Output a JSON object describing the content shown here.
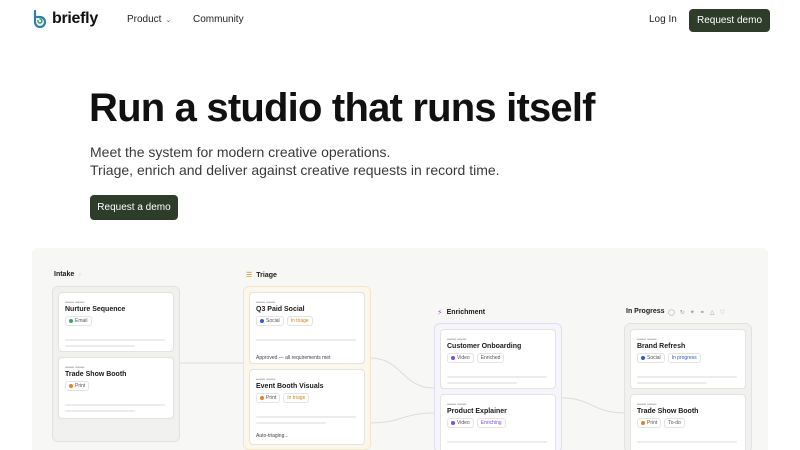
{
  "nav": {
    "brand": "briefly",
    "product": "Product",
    "community": "Community",
    "login": "Log In",
    "cta": "Request demo"
  },
  "hero": {
    "title": "Run a studio that runs itself",
    "subtitle_line1": "Meet the system for modern creative operations.",
    "subtitle_line2": "Triage, enrich and deliver against creative requests in record time.",
    "cta": "Request a demo"
  },
  "colors": {
    "brand": "#2e3d29",
    "email": "#3aa36a",
    "social": "#2f5bd3",
    "print": "#e8802a",
    "video": "#7a52d6",
    "triage_status": "#d08a1e",
    "enriching_status": "#7a52d6",
    "progress_status": "#2f5bd3"
  },
  "board": {
    "columns": [
      {
        "name": "Intake",
        "cards": [
          {
            "title": "Nurture Sequence",
            "tags": [
              {
                "label": "Email",
                "color": "#3aa36a"
              }
            ]
          },
          {
            "title": "Trade Show Booth",
            "tags": [
              {
                "label": "Print",
                "color": "#e8802a"
              }
            ]
          }
        ]
      },
      {
        "name": "Triage",
        "cards": [
          {
            "title": "Q3 Paid Social",
            "tags": [
              {
                "label": "Social",
                "color": "#2f5bd3"
              }
            ],
            "status": "In triage",
            "footer": "Approved — all requirements met"
          },
          {
            "title": "Event Booth Visuals",
            "tags": [
              {
                "label": "Print",
                "color": "#e8802a"
              }
            ],
            "status": "In triage",
            "footer": "Auto-triaging..."
          }
        ]
      },
      {
        "name": "Enrichment",
        "cards": [
          {
            "title": "Customer Onboarding",
            "tags": [
              {
                "label": "Video",
                "color": "#7a52d6"
              }
            ],
            "status": "Enriched"
          },
          {
            "title": "Product Explainer",
            "tags": [
              {
                "label": "Video",
                "color": "#7a52d6"
              }
            ],
            "status": "Enriching"
          }
        ]
      },
      {
        "name": "In Progress",
        "cards": [
          {
            "title": "Brand Refresh",
            "tags": [
              {
                "label": "Social",
                "color": "#2f5bd3"
              }
            ],
            "status": "In progress"
          },
          {
            "title": "Trade Show Booth",
            "tags": [
              {
                "label": "Print",
                "color": "#e8802a"
              }
            ],
            "status": "To-do"
          }
        ]
      }
    ]
  }
}
